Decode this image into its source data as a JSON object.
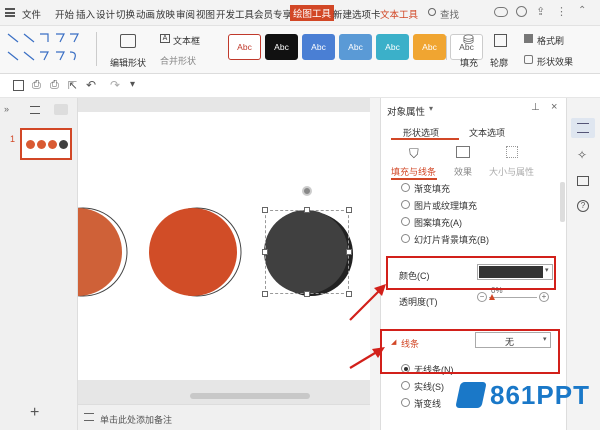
{
  "menubar": {
    "hamburger_icon": "menu-icon",
    "items": [
      "文件",
      "开始",
      "插入",
      "设计",
      "切换",
      "动画",
      "放映",
      "审阅",
      "视图",
      "开发工具",
      "会员专享",
      "绘图工具",
      "新建选项卡",
      "文本工具"
    ],
    "active_item": "绘图工具",
    "search_label": "查找"
  },
  "ribbon": {
    "edit_shape_label": "编辑形状",
    "textbox_label": "文本框",
    "merge_shape_label": "合并形状",
    "style_buttons": [
      {
        "label": "Abc",
        "bg": "#ffffff",
        "fg": "#c0392b",
        "border": "#c0392b"
      },
      {
        "label": "Abc",
        "bg": "#111111",
        "fg": "#ffffff",
        "border": "#111111"
      },
      {
        "label": "Abc",
        "bg": "#4a7fd4",
        "fg": "#ffffff",
        "border": "#4a7fd4"
      },
      {
        "label": "Abc",
        "bg": "#5a9ad6",
        "fg": "#ffffff",
        "border": "#5a9ad6"
      },
      {
        "label": "Abc",
        "bg": "#3bb0c9",
        "fg": "#ffffff",
        "border": "#3bb0c9"
      },
      {
        "label": "Abc",
        "bg": "#f0a531",
        "fg": "#ffffff",
        "border": "#f0a531"
      },
      {
        "label": "Abc",
        "bg": "#ffffff",
        "fg": "#555555",
        "border": "#cccccc"
      }
    ],
    "fill_label": "填充",
    "outline_label": "轮廓",
    "format_painter_label": "格式刷",
    "shape_effect_label": "形状效果"
  },
  "slide_panel": {
    "slide_number": "1",
    "add_label": "+"
  },
  "notes": {
    "placeholder": "单击此处添加备注"
  },
  "pane": {
    "title": "对象属性",
    "tabs": [
      "形状选项",
      "文本选项"
    ],
    "active_tab": "形状选项",
    "subtabs": [
      "填充与线条",
      "效果",
      "大小与属性"
    ],
    "active_subtab": "填充与线条",
    "fill_options": [
      "渐变填充",
      "图片或纹理填充",
      "图案填充(A)",
      "幻灯片背景填充(B)"
    ],
    "color_label": "颜色(C)",
    "color_value": "#333333",
    "transparency_label": "透明度(T)",
    "transparency_value": "0%",
    "line_section_label": "线条",
    "line_value": "无",
    "line_options": [
      "无线条(N)",
      "实线(S)",
      "渐变线"
    ],
    "selected_line_option": "无线条(N)"
  },
  "watermark": {
    "text": "861PPT"
  },
  "colors": {
    "accent_red": "#d24726",
    "circle_orange": "#d95a33",
    "circle_dark": "#404040",
    "annotation_red": "#d2201a"
  }
}
